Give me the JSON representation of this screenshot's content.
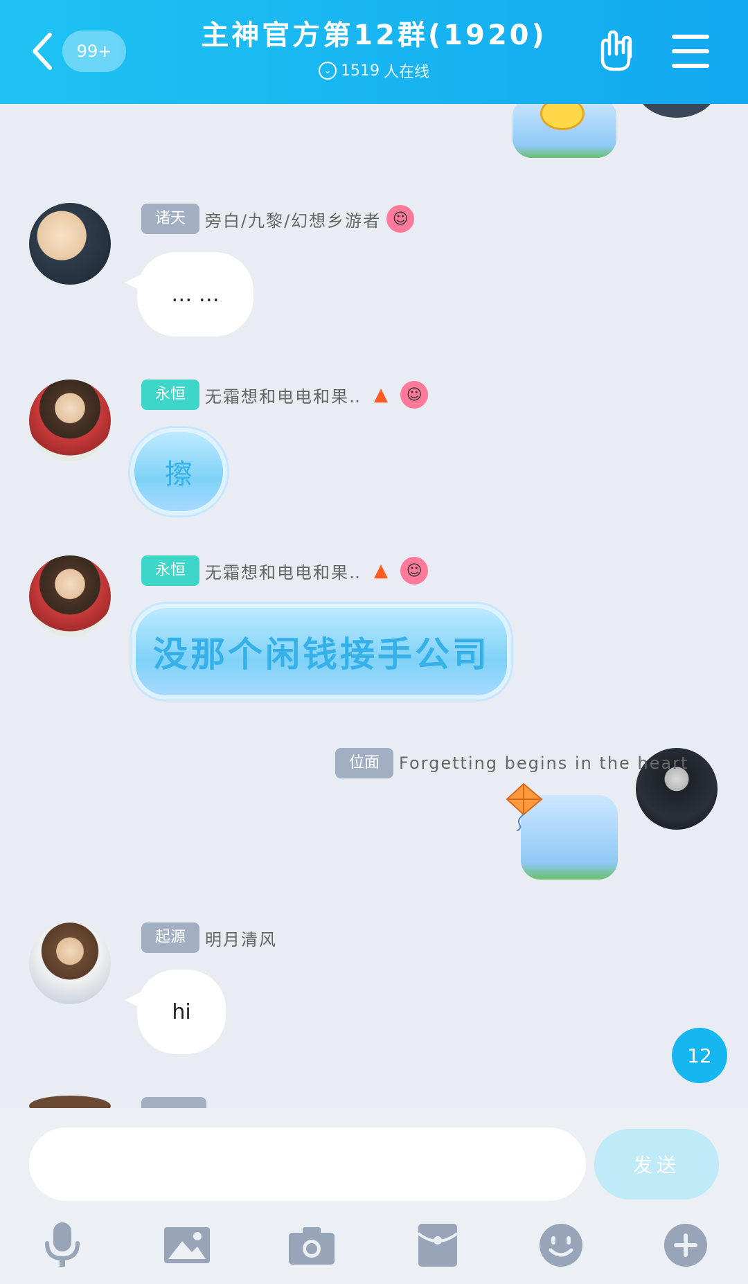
{
  "header": {
    "unread_badge": "99+",
    "title": "主神官方第12群(1920)",
    "online_count": "1519",
    "online_label": "人在线"
  },
  "messages": [
    {
      "tag": "诸天",
      "nick": "旁白/九黎/幻想乡游者",
      "text": "… …"
    },
    {
      "tag": "永恒",
      "nick": "无霜想和电电和果‥",
      "text": "擦"
    },
    {
      "tag": "永恒",
      "nick": "无霜想和电电和果‥",
      "text": "没那个闲钱接手公司"
    },
    {
      "tag": "位面",
      "nick": "Forgetting begins in the heart",
      "text": ""
    },
    {
      "tag": "起源",
      "nick": "明月清风",
      "text": "hi"
    }
  ],
  "scroll_badge": "12",
  "composer": {
    "input_value": "",
    "send_label": "发送"
  },
  "toolbar": {
    "icons": [
      "microphone-icon",
      "image-icon",
      "camera-icon",
      "red-packet-icon",
      "emoji-icon",
      "plus-icon"
    ]
  },
  "colors": {
    "header_start": "#1fc3f3",
    "header_end": "#12a8f0",
    "background": "#e9edf3",
    "tag_gray": "#a2afc3",
    "tag_teal": "#3dd6c8",
    "accent": "#16b7f1"
  }
}
